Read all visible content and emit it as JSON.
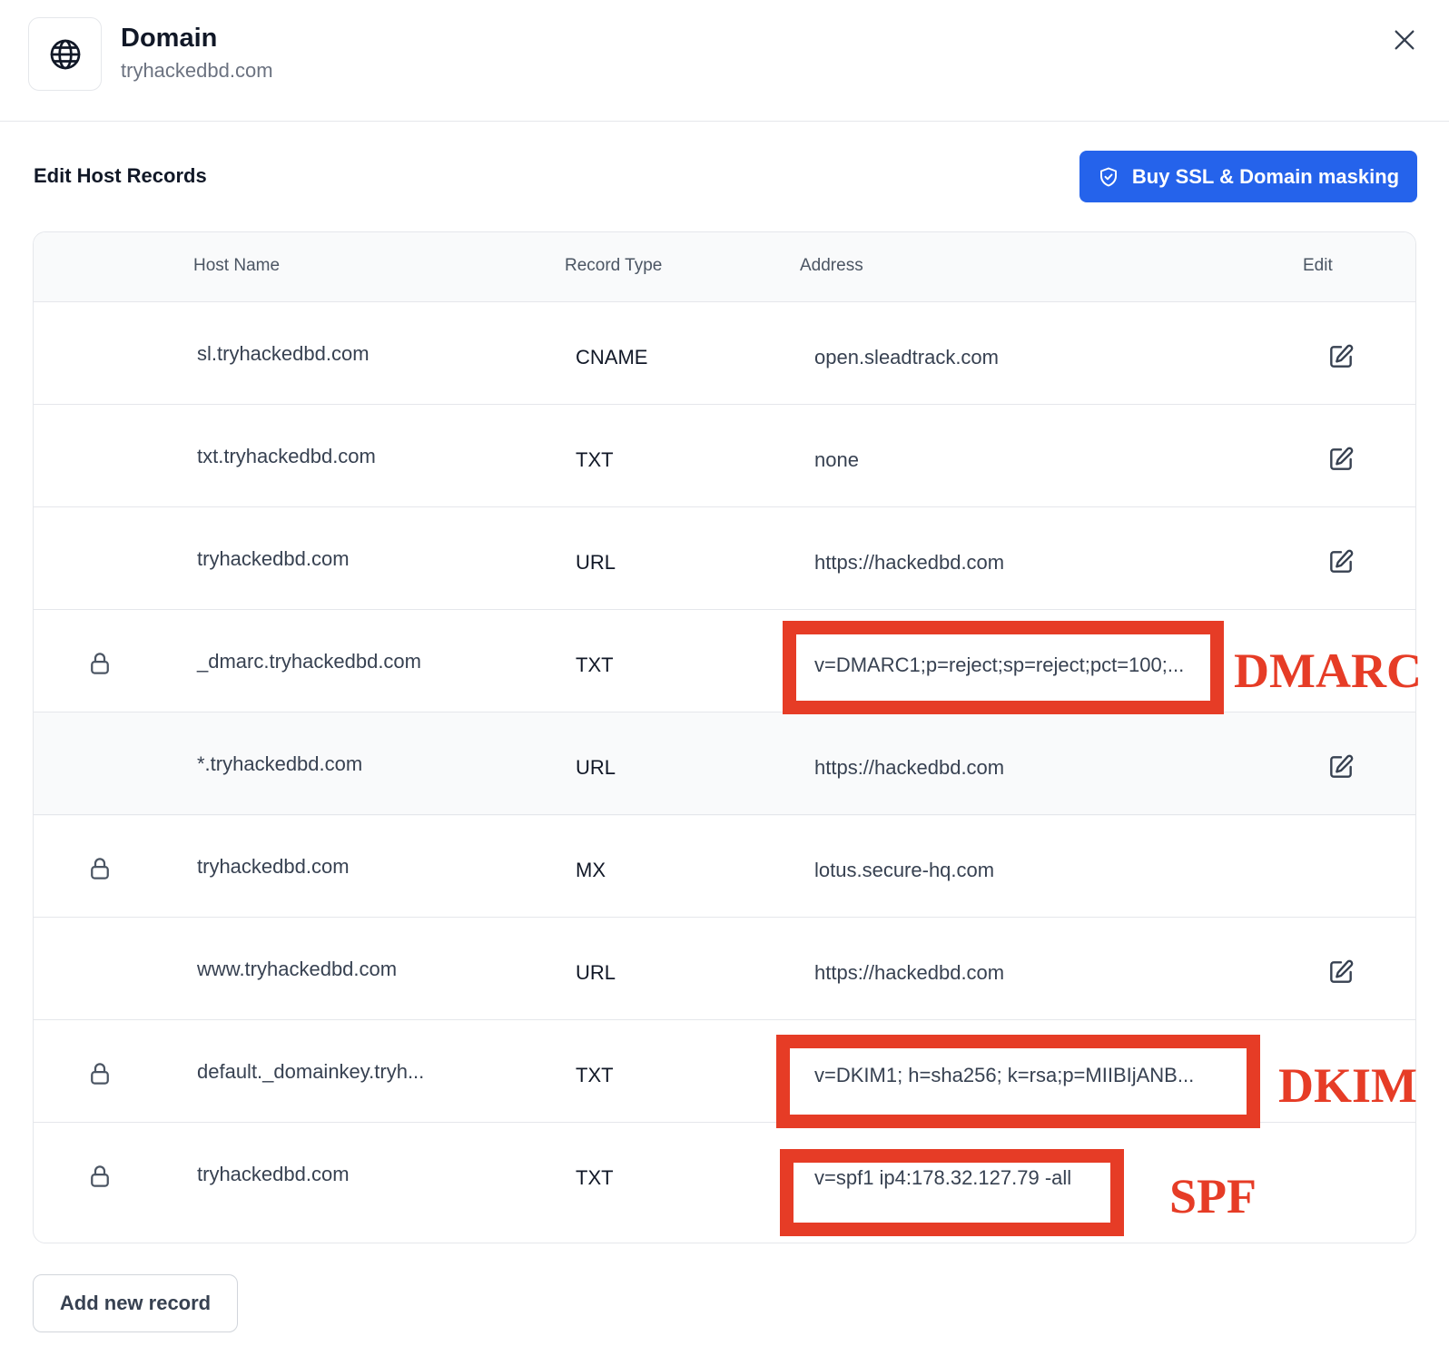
{
  "header": {
    "title": "Domain",
    "domain": "tryhackedbd.com",
    "icon": "globe-icon",
    "close_icon": "close-icon"
  },
  "section": {
    "title": "Edit Host Records",
    "buy_button_label": "Buy SSL & Domain masking",
    "buy_button_icon": "shield-check-icon"
  },
  "table": {
    "columns": [
      "",
      "Host Name",
      "Record Type",
      "Address",
      "Edit"
    ],
    "rows": [
      {
        "locked": false,
        "host": "sl.tryhackedbd.com",
        "type": "CNAME",
        "address": "open.sleadtrack.com",
        "editable": true
      },
      {
        "locked": false,
        "host": "txt.tryhackedbd.com",
        "type": "TXT",
        "address": "none",
        "editable": true
      },
      {
        "locked": false,
        "host": "tryhackedbd.com",
        "type": "URL",
        "address": "https://hackedbd.com",
        "editable": true
      },
      {
        "locked": true,
        "host": "_dmarc.tryhackedbd.com",
        "type": "TXT",
        "address": "v=DMARC1;p=reject;sp=reject;pct=100;...",
        "editable": false
      },
      {
        "locked": false,
        "host": "*.tryhackedbd.com",
        "type": "URL",
        "address": "https://hackedbd.com",
        "editable": true
      },
      {
        "locked": true,
        "host": "tryhackedbd.com",
        "type": "MX",
        "address": "lotus.secure-hq.com",
        "editable": false
      },
      {
        "locked": false,
        "host": "www.tryhackedbd.com",
        "type": "URL",
        "address": "https://hackedbd.com",
        "editable": true
      },
      {
        "locked": true,
        "host": "default._domainkey.tryh...",
        "type": "TXT",
        "address": "v=DKIM1; h=sha256; k=rsa;p=MIIBIjANB...",
        "editable": false
      },
      {
        "locked": true,
        "host": "tryhackedbd.com",
        "type": "TXT",
        "address": "v=spf1 ip4:178.32.127.79 -all",
        "editable": false
      }
    ]
  },
  "annotations": {
    "dmarc": "DMARC",
    "dkim": "DKIM",
    "spf": "SPF",
    "color": "#e63c26"
  },
  "footer": {
    "add_button_label": "Add new record"
  },
  "colors": {
    "accent": "#2563eb",
    "hover_row": "#f9fafb"
  }
}
